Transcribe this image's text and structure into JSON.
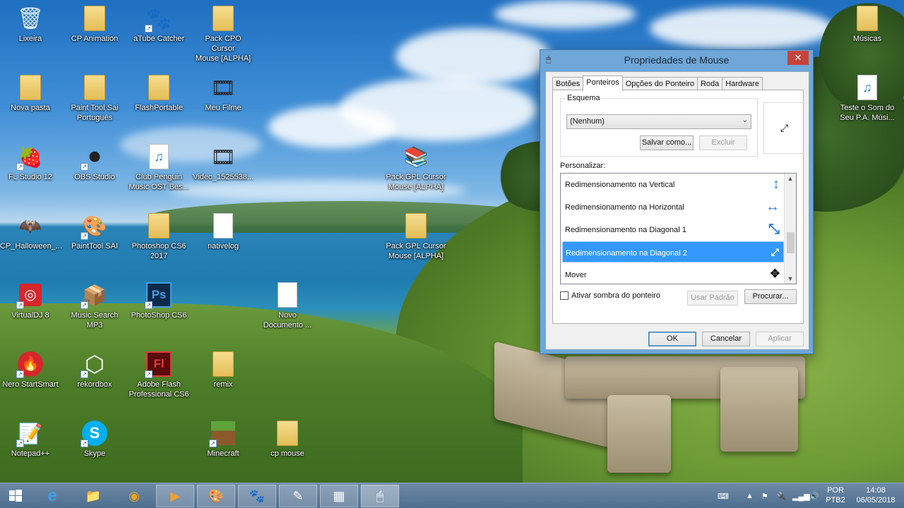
{
  "desktop": {
    "icons": [
      {
        "label": "Lixeira",
        "icon": "recycle-bin-icon",
        "glyph": "🗑"
      },
      {
        "label": "CP Animation",
        "icon": "folder-icon",
        "glyph": ""
      },
      {
        "label": "aTube Catcher",
        "icon": "atube-catcher-icon",
        "glyph": "🐾"
      },
      {
        "label": "Pack CPO Cursor\nMouse [ALPHA]",
        "icon": "folder-icon",
        "glyph": ""
      },
      {
        "label": "Nova pasta",
        "icon": "folder-icon",
        "glyph": ""
      },
      {
        "label": "Paint Tool Sai\nPortuguês",
        "icon": "folder-icon",
        "glyph": ""
      },
      {
        "label": "FlashPortable",
        "icon": "folder-icon",
        "glyph": ""
      },
      {
        "label": "Meu Filme",
        "icon": "movie-icon",
        "glyph": "🎞"
      },
      {
        "label": "FL Studio 12",
        "icon": "fl-studio-icon",
        "glyph": "🍓"
      },
      {
        "label": "OBS Studio",
        "icon": "obs-icon",
        "glyph": "⏺"
      },
      {
        "label": "Club Penguin\nMusic OST Bes...",
        "icon": "mp3-file-icon",
        "glyph": "♫"
      },
      {
        "label": "Video_1525538...",
        "icon": "video-file-icon",
        "glyph": "🎞"
      },
      {
        "label": "Pack GPL Cursor\nMouse [ALPHA]",
        "icon": "winrar-icon",
        "glyph": "📚"
      },
      {
        "label": "CP_Halloween_...",
        "icon": "image-file-icon",
        "glyph": "🦇"
      },
      {
        "label": "PaintTool SAI",
        "icon": "painttool-sai-icon",
        "glyph": "🎨"
      },
      {
        "label": "Photoshop CS6\n2017",
        "icon": "folder-icon",
        "glyph": ""
      },
      {
        "label": "nativelog",
        "icon": "text-file-icon",
        "glyph": ""
      },
      {
        "label": "Pack GPL Cursor\nMouse [ALPHA]",
        "icon": "folder-icon",
        "glyph": ""
      },
      {
        "label": "VirtualDJ 8",
        "icon": "virtualdj-icon",
        "glyph": "◎"
      },
      {
        "label": "Music Search\nMP3",
        "icon": "music-search-icon",
        "glyph": "📦"
      },
      {
        "label": "PhotoShop CS6",
        "icon": "photoshop-icon",
        "glyph": "Ps"
      },
      {
        "label": "Novo\nDocumento ...",
        "icon": "text-file-icon",
        "glyph": ""
      },
      {
        "label": "Nero StartSmart",
        "icon": "nero-icon",
        "glyph": "🔥"
      },
      {
        "label": "rekordbox",
        "icon": "rekordbox-icon",
        "glyph": "⬡"
      },
      {
        "label": "Adobe Flash\nProfessional CS6",
        "icon": "adobe-flash-icon",
        "glyph": "Fl"
      },
      {
        "label": "remix",
        "icon": "folder-icon",
        "glyph": ""
      },
      {
        "label": "Notepad++",
        "icon": "notepadpp-icon",
        "glyph": "📝"
      },
      {
        "label": "Skype",
        "icon": "skype-icon",
        "glyph": "S"
      },
      {
        "label": "Minecraft",
        "icon": "minecraft-icon",
        "glyph": "▩"
      },
      {
        "label": "cp mouse",
        "icon": "folder-icon",
        "glyph": ""
      },
      {
        "label": "Músicas",
        "icon": "folder-icon",
        "glyph": ""
      },
      {
        "label": "Teste o Som do\nSeu P.A. Músi...",
        "icon": "mp3-file-icon",
        "glyph": "♫"
      }
    ]
  },
  "dialog": {
    "title": "Propriedades de Mouse",
    "close_glyph": "✕",
    "tabs": [
      "Botões",
      "Ponteiros",
      "Opções do Ponteiro",
      "Roda",
      "Hardware"
    ],
    "active_tab": "Ponteiros",
    "scheme": {
      "group_label": "Esquema",
      "selected": "(Nenhum)",
      "save_label": "Salvar como...",
      "delete_label": "Excluir"
    },
    "preview_glyph": "⤢",
    "customize_label": "Personalizar:",
    "cursor_rows": [
      {
        "label": "Redimensionamento na Vertical",
        "glyph": "↕"
      },
      {
        "label": "Redimensionamento na Horizontal",
        "glyph": "↔"
      },
      {
        "label": "Redimensionamento na Diagonal 1",
        "glyph": "⤡"
      },
      {
        "label": "Redimensionamento na Diagonal 2",
        "glyph": "⤢"
      },
      {
        "label": "Mover",
        "glyph": "✥"
      }
    ],
    "selected_row": 3,
    "shadow_label": "Ativar sombra do ponteiro",
    "default_label": "Usar Padrão",
    "browse_label": "Procurar...",
    "ok_label": "OK",
    "cancel_label": "Cancelar",
    "apply_label": "Aplicar"
  },
  "taskbar": {
    "apps": [
      {
        "name": "internet-explorer-icon",
        "glyph": "e"
      },
      {
        "name": "file-explorer-icon",
        "glyph": "📁"
      },
      {
        "name": "chrome-icon",
        "glyph": "◉"
      },
      {
        "name": "media-player-icon",
        "glyph": "▶"
      },
      {
        "name": "painttool-sai-icon",
        "glyph": "🎨"
      },
      {
        "name": "atube-catcher-icon",
        "glyph": "🐾"
      },
      {
        "name": "notepad-icon",
        "glyph": "✎"
      },
      {
        "name": "control-panel-icon",
        "glyph": "▦"
      },
      {
        "name": "mouse-properties-icon",
        "glyph": "🖱"
      }
    ],
    "language_line1": "POR",
    "language_line2": "PTB2",
    "time": "14:08",
    "date": "06/05/2018"
  }
}
